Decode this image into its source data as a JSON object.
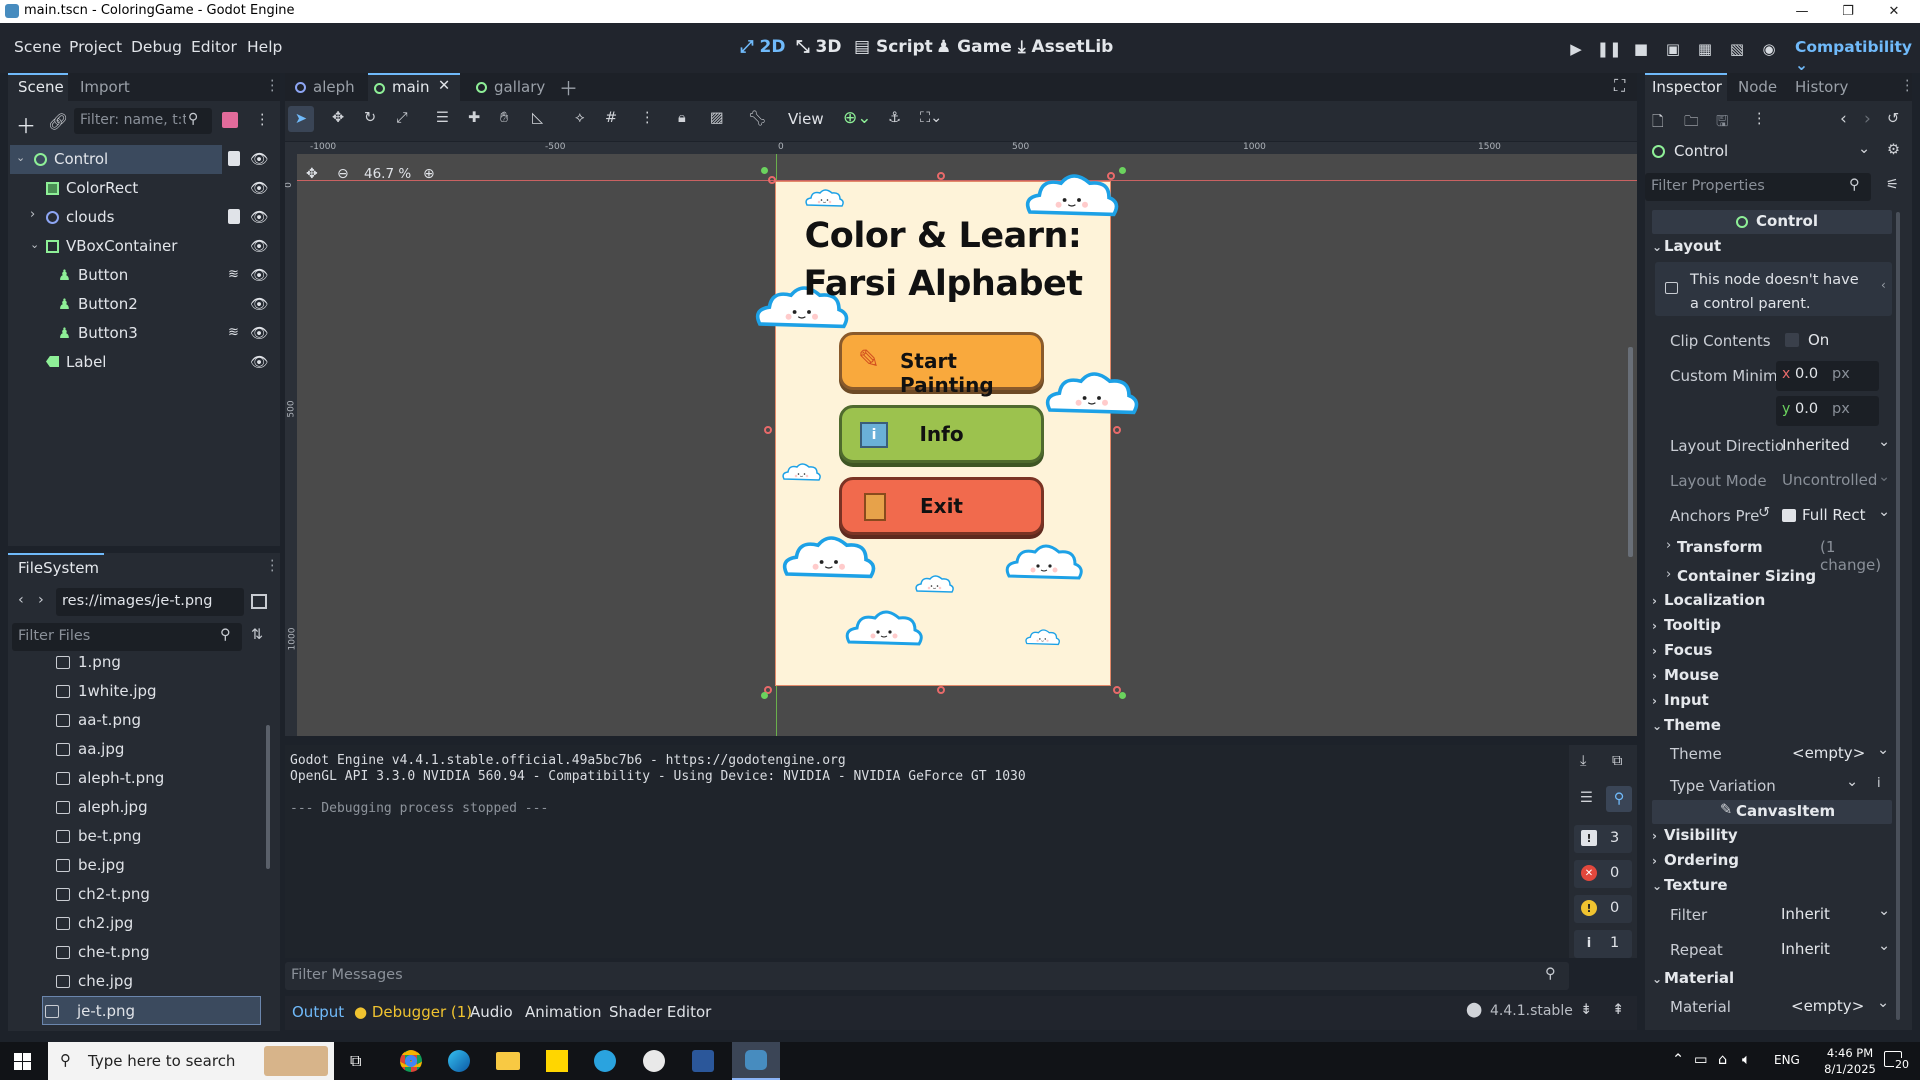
{
  "window": {
    "title": "main.tscn - ColoringGame - Godot Engine"
  },
  "menus": [
    "Scene",
    "Project",
    "Debug",
    "Editor",
    "Help"
  ],
  "workspaces": [
    "2D",
    "3D",
    "Script",
    "Game",
    "AssetLib"
  ],
  "renderer": "Compatibility",
  "scene_dock": {
    "tabs": [
      "Scene",
      "Import"
    ],
    "filter_placeholder": "Filter: name, t:t",
    "nodes": [
      {
        "name": "Control",
        "type": "control"
      },
      {
        "name": "ColorRect",
        "type": "colorrect"
      },
      {
        "name": "clouds",
        "type": "node2d"
      },
      {
        "name": "VBoxContainer",
        "type": "container"
      },
      {
        "name": "Button",
        "type": "button"
      },
      {
        "name": "Button2",
        "type": "button"
      },
      {
        "name": "Button3",
        "type": "button"
      },
      {
        "name": "Label",
        "type": "label"
      }
    ]
  },
  "filesystem": {
    "title": "FileSystem",
    "path": "res://images/je-t.png",
    "filter_placeholder": "Filter Files",
    "files": [
      "1.png",
      "1white.jpg",
      "aa-t.png",
      "aa.jpg",
      "aleph-t.png",
      "aleph.jpg",
      "be-t.png",
      "be.jpg",
      "ch2-t.png",
      "ch2.jpg",
      "che-t.png",
      "che.jpg",
      "je-t.png"
    ]
  },
  "scene_tabs": [
    "aleph",
    "main",
    "gallary"
  ],
  "toolbar": {
    "view": "View",
    "zoom": "46.7 %"
  },
  "ruler": {
    "h": [
      "-1000",
      "-500",
      "0",
      "500",
      "1000",
      "1500"
    ],
    "v": [
      "0",
      "500",
      "1000"
    ]
  },
  "game": {
    "title_line1": "Color & Learn:",
    "title_line2": "Farsi Alphabet",
    "buttons": [
      {
        "label": "Start Painting",
        "color": "#f9a93d"
      },
      {
        "label": "Info",
        "color": "#9cc24e"
      },
      {
        "label": "Exit",
        "color": "#f16a4d"
      }
    ],
    "bg": "#fef3d9"
  },
  "output": {
    "lines": [
      "Godot Engine v4.4.1.stable.official.49a5bc7b6 - https://godotengine.org",
      "OpenGL API 3.3.0 NVIDIA 560.94 - Compatibility - Using Device: NVIDIA - NVIDIA GeForce GT 1030",
      "",
      "--- Debugging process stopped ---"
    ],
    "filter_placeholder": "Filter Messages",
    "counts": [
      "3",
      "0",
      "0",
      "1"
    ]
  },
  "bottom_tabs": [
    "Output",
    "Debugger (1)",
    "Audio",
    "Animation",
    "Shader Editor"
  ],
  "version": "4.4.1.stable",
  "inspector": {
    "tabs": [
      "Inspector",
      "Node",
      "History"
    ],
    "node": "Control",
    "filter_placeholder": "Filter Properties",
    "class_header": "Control",
    "layout_title": "Layout",
    "warning": "This node doesn't have a control parent.",
    "clip_contents": "Clip Contents",
    "clip_on": "On",
    "custom_min": "Custom Minim",
    "x": "0.0",
    "y": "0.0",
    "px": "px",
    "layout_direction": "Layout Directio",
    "layout_direction_val": "Inherited",
    "layout_mode": "Layout Mode",
    "layout_mode_val": "Uncontrolled",
    "anchors": "Anchors Pre",
    "anchors_val": "Full Rect",
    "transform": "Transform",
    "transform_note": "(1 change)",
    "container_sizing": "Container Sizing",
    "sections": [
      "Localization",
      "Tooltip",
      "Focus",
      "Mouse",
      "Input"
    ],
    "theme_title": "Theme",
    "theme": "Theme",
    "theme_val": "<empty>",
    "type_variation": "Type Variation",
    "canvasitem": "CanvasItem",
    "visibility": "Visibility",
    "ordering": "Ordering",
    "texture": "Texture",
    "filter": "Filter",
    "filter_val": "Inherit",
    "repeat": "Repeat",
    "repeat_val": "Inherit",
    "material_title": "Material",
    "material": "Material",
    "material_val": "<empty>"
  },
  "taskbar": {
    "search": "Type here to search",
    "time": "4:46 PM",
    "date": "8/1/2025",
    "lang": "ENG",
    "notif": "20"
  },
  "colors": {
    "accent": "#70bafa",
    "control_green": "#8eef97",
    "node_blue": "#8da5f3"
  }
}
